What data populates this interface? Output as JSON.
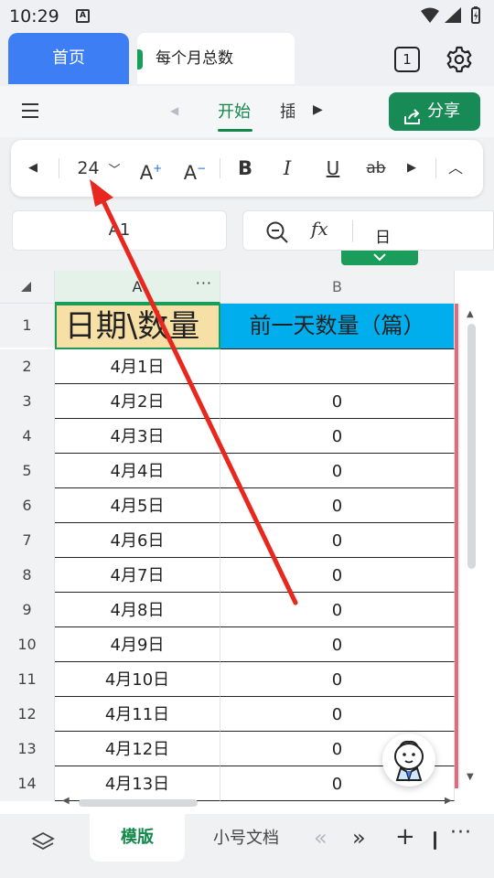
{
  "status_bar": {
    "time": "10:29",
    "notification_icon": "A"
  },
  "tabs": {
    "home": "首页",
    "document": "每个月总数",
    "open_count": "1"
  },
  "toolbar": {
    "ribbon_active": "开始",
    "ribbon_next": "插入",
    "share": "分享"
  },
  "format": {
    "font_size": "24",
    "bold": "B",
    "italic": "I",
    "underline": "U",
    "strike": "ab"
  },
  "formula": {
    "cell_ref": "A1",
    "fx": "fx",
    "content": "日"
  },
  "grid": {
    "columns": [
      "A",
      "B"
    ],
    "header_row": {
      "num": "1",
      "a": "日期\\数量",
      "b": "前一天数量（篇）"
    },
    "rows": [
      {
        "num": "2",
        "a": "4月1日",
        "b": ""
      },
      {
        "num": "3",
        "a": "4月2日",
        "b": "0"
      },
      {
        "num": "4",
        "a": "4月3日",
        "b": "0"
      },
      {
        "num": "5",
        "a": "4月4日",
        "b": "0"
      },
      {
        "num": "6",
        "a": "4月5日",
        "b": "0"
      },
      {
        "num": "7",
        "a": "4月6日",
        "b": "0"
      },
      {
        "num": "8",
        "a": "4月7日",
        "b": "0"
      },
      {
        "num": "9",
        "a": "4月8日",
        "b": "0"
      },
      {
        "num": "10",
        "a": "4月9日",
        "b": "0"
      },
      {
        "num": "11",
        "a": "4月10日",
        "b": "0"
      },
      {
        "num": "12",
        "a": "4月11日",
        "b": "0"
      },
      {
        "num": "13",
        "a": "4月12日",
        "b": "0"
      },
      {
        "num": "14",
        "a": "4月13日",
        "b": "0"
      }
    ]
  },
  "sheets": {
    "active": "模版",
    "other": "小号文档"
  },
  "colors": {
    "accent_green": "#1a9c5a",
    "tab_blue": "#3d7ef5",
    "header_a_bg": "#f7e0a6",
    "header_b_bg": "#00aeee",
    "arrow_red": "#e8281e"
  }
}
